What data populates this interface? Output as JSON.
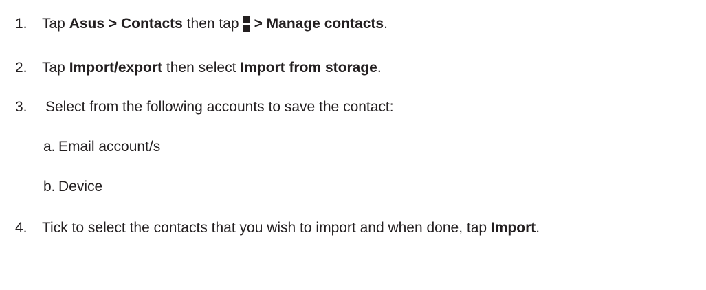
{
  "steps": [
    {
      "number": "1.",
      "parts": {
        "p1": "Tap ",
        "p2": "Asus > Contacts",
        "p3": " then tap",
        "icon": "overflow-menu-icon",
        "p4": "> Manage contacts",
        "p5": "."
      }
    },
    {
      "number": "2.",
      "parts": {
        "p1": "Tap ",
        "p2": "Import/export",
        "p3": " then select ",
        "p4": "Import from storage",
        "p5": "."
      }
    },
    {
      "number": "3.",
      "text": "Select from the following accounts to save the contact:"
    },
    {
      "number": "4.",
      "parts": {
        "p1": "Tick to select the contacts that you wish to import and when done, tap ",
        "p2": "Import",
        "p3": "."
      }
    }
  ],
  "sub_steps": [
    {
      "letter": "a.",
      "text": "Email account/s"
    },
    {
      "letter": "b.",
      "text": "Device"
    }
  ]
}
